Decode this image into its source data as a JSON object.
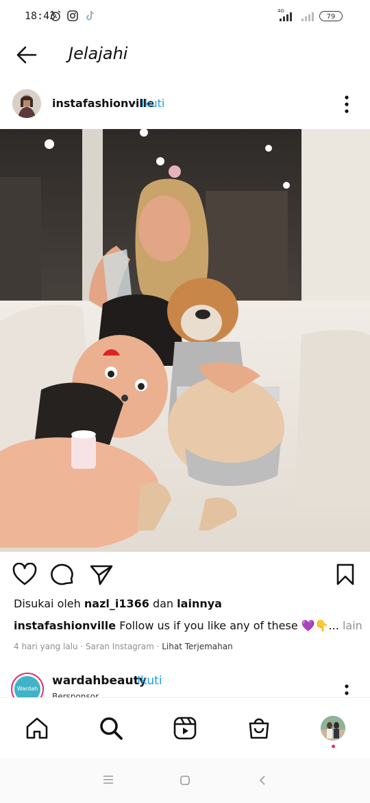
{
  "status_bar": {
    "time": "18:43",
    "battery": "79",
    "network": "4G"
  },
  "app_bar": {
    "title": "Jelajahi"
  },
  "post": {
    "username": "instafashionville",
    "separator": "·",
    "follow_label": "Ikuti",
    "likes_prefix": "Disukai oleh",
    "likes_user": "nazl_i1366",
    "likes_mid": "dan",
    "likes_others": "lainnya",
    "caption_user": "instafashionville",
    "caption_text": "Follow us if you like any of these 💜👇...",
    "caption_more": "lainnya",
    "meta_time": "4 hari yang lalu · Saran Instagram ·",
    "meta_translate": "Lihat Terjemahan"
  },
  "next_post": {
    "username": "wardahbeauty",
    "separator": "·",
    "follow_label": "Ikuti",
    "subtitle": "Bersponsor",
    "avatar_text": "Wardah"
  },
  "icons": {
    "status": [
      "alarm-icon",
      "instagram-icon",
      "tiktok-icon",
      "signal-icon",
      "battery-icon"
    ],
    "actions": [
      "like-icon",
      "comment-icon",
      "share-icon",
      "bookmark-icon"
    ],
    "nav": [
      "home-icon",
      "search-icon",
      "reels-icon",
      "shop-icon",
      "profile-icon"
    ],
    "system": [
      "menu-icon",
      "home-square-icon",
      "back-chevron-icon"
    ]
  },
  "colors": {
    "accent_blue": "#1a9be6",
    "story_ring": "#e0336e",
    "meta_gray": "#8e8e8e"
  }
}
